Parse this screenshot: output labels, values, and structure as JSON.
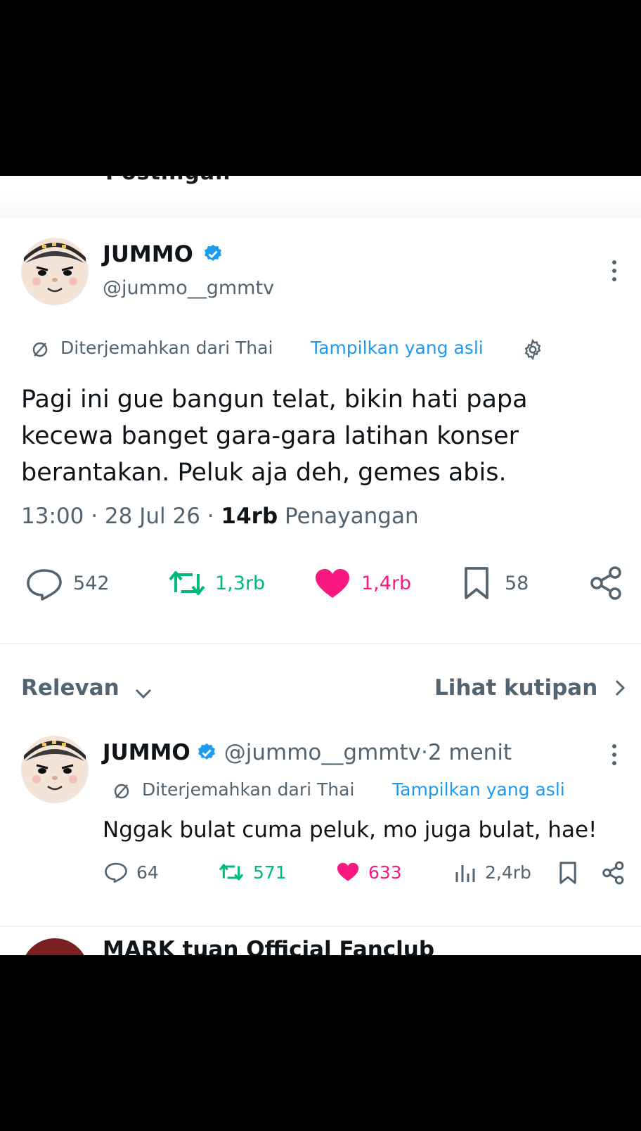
{
  "header": {
    "title": "Postingan"
  },
  "post": {
    "author_name": "JUMMO",
    "handle": "@jummo__gmmtv",
    "translated_label": "Diterjemahkan dari Thai",
    "show_original": "Tampilkan yang asli",
    "body_lines": [
      "Pagi ini gue bangun telat, bikin hati papa",
      "kecewa banget gara-gara latihan konser",
      "berantakan. Peluk aja deh, gemes abis."
    ],
    "time": "13:00",
    "date": "28 Jul 26",
    "views_count": "14rb",
    "views_label": "Penayangan",
    "stats": {
      "replies": "542",
      "reposts": "1,3rb",
      "likes": "1,4rb",
      "bookmarks": "58"
    }
  },
  "replies_bar": {
    "sort_label": "Relevan",
    "quotes_link": "Lihat kutipan"
  },
  "reply": {
    "author_name": "JUMMO",
    "handle": "@jummo__gmmtv",
    "time_ago": "2 menit",
    "translated_label": "Diterjemahkan dari Thai",
    "show_original": "Tampilkan yang asli",
    "text": "Nggak bulat cuma peluk, mo juga bulat, hae!",
    "stats": {
      "replies": "64",
      "reposts": "571",
      "likes": "633",
      "views": "2,4rb"
    }
  },
  "next_reply_partial": {
    "author_name": "MARK tuan Official Fanclub"
  },
  "colors": {
    "accent": "#1d9bf0",
    "repost": "#00ba7c",
    "like": "#f91880",
    "muted": "#536471"
  }
}
